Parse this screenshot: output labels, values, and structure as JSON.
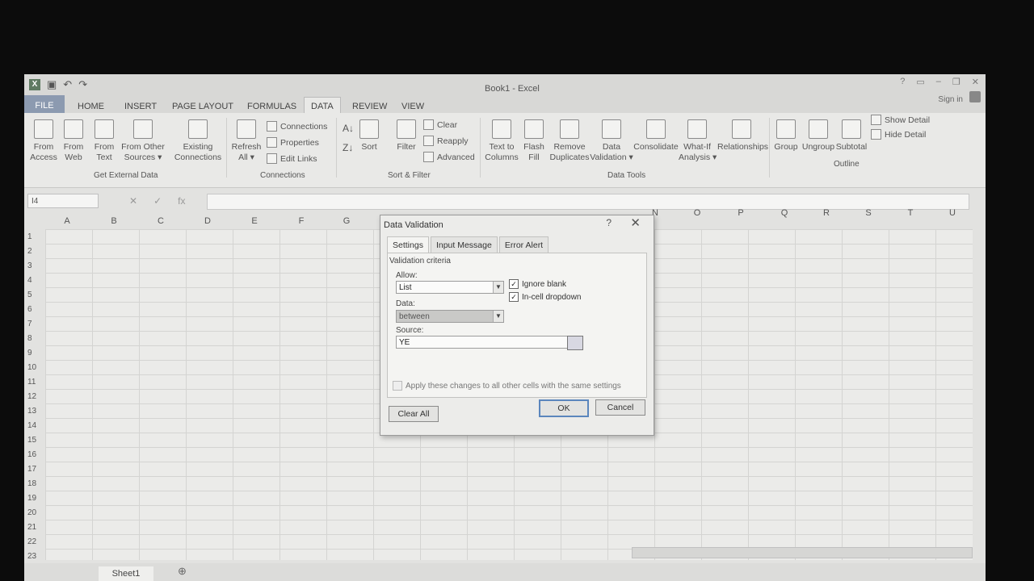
{
  "app": {
    "title": "Book1 - Excel",
    "signin": "Sign in",
    "qat": {
      "undo": "↶",
      "redo": "↷"
    }
  },
  "tabs": [
    "FILE",
    "HOME",
    "INSERT",
    "PAGE LAYOUT",
    "FORMULAS",
    "DATA",
    "REVIEW",
    "VIEW"
  ],
  "ribbon": {
    "get_external": {
      "access": "From\nAccess",
      "web": "From\nWeb",
      "text": "From\nText",
      "other": "From Other\nSources ▾",
      "existing": "Existing\nConnections",
      "label": "Get External Data"
    },
    "connections": {
      "refresh": "Refresh\nAll ▾",
      "connections": "Connections",
      "properties": "Properties",
      "edit_links": "Edit Links",
      "label": "Connections"
    },
    "sort_filter": {
      "sort": "Sort",
      "filter": "Filter",
      "clear": "Clear",
      "reapply": "Reapply",
      "advanced": "Advanced",
      "label": "Sort & Filter"
    },
    "data_tools": {
      "text_to_columns": "Text to\nColumns",
      "flash_fill": "Flash\nFill",
      "remove_duplicates": "Remove\nDuplicates",
      "data_validation": "Data\nValidation ▾",
      "consolidate": "Consolidate",
      "what_if": "What-If\nAnalysis ▾",
      "relationships": "Relationships",
      "label": "Data Tools"
    },
    "outline": {
      "group": "Group",
      "ungroup": "Ungroup",
      "subtotal": "Subtotal",
      "show_detail": "Show Detail",
      "hide_detail": "Hide Detail",
      "label": "Outline"
    }
  },
  "formula_bar": {
    "name_box": "I4",
    "cancel": "✕",
    "enter": "✓",
    "fx": "fx"
  },
  "columns_left": [
    "A",
    "B",
    "C",
    "D",
    "E",
    "F",
    "G"
  ],
  "columns_right": [
    "N",
    "O",
    "P",
    "Q",
    "R",
    "S",
    "T",
    "U"
  ],
  "rows": [
    "1",
    "2",
    "3",
    "4",
    "5",
    "6",
    "7",
    "8",
    "9",
    "10",
    "11",
    "12",
    "13",
    "14",
    "15",
    "16",
    "17",
    "18",
    "19",
    "20",
    "21",
    "22",
    "23"
  ],
  "sheet_tab": "Sheet1",
  "dialog": {
    "title": "Data Validation",
    "help": "?",
    "close": "✕",
    "tabs": [
      "Settings",
      "Input Message",
      "Error Alert"
    ],
    "criteria_label": "Validation criteria",
    "allow_label": "Allow:",
    "allow_value": "List",
    "data_label": "Data:",
    "data_value": "between",
    "ignore_blank": "Ignore blank",
    "in_cell_dropdown": "In-cell dropdown",
    "source_label": "Source:",
    "source_value": "YE",
    "apply_all": "Apply these changes to all other cells with the same settings",
    "clear_all": "Clear All",
    "ok": "OK",
    "cancel": "Cancel"
  }
}
